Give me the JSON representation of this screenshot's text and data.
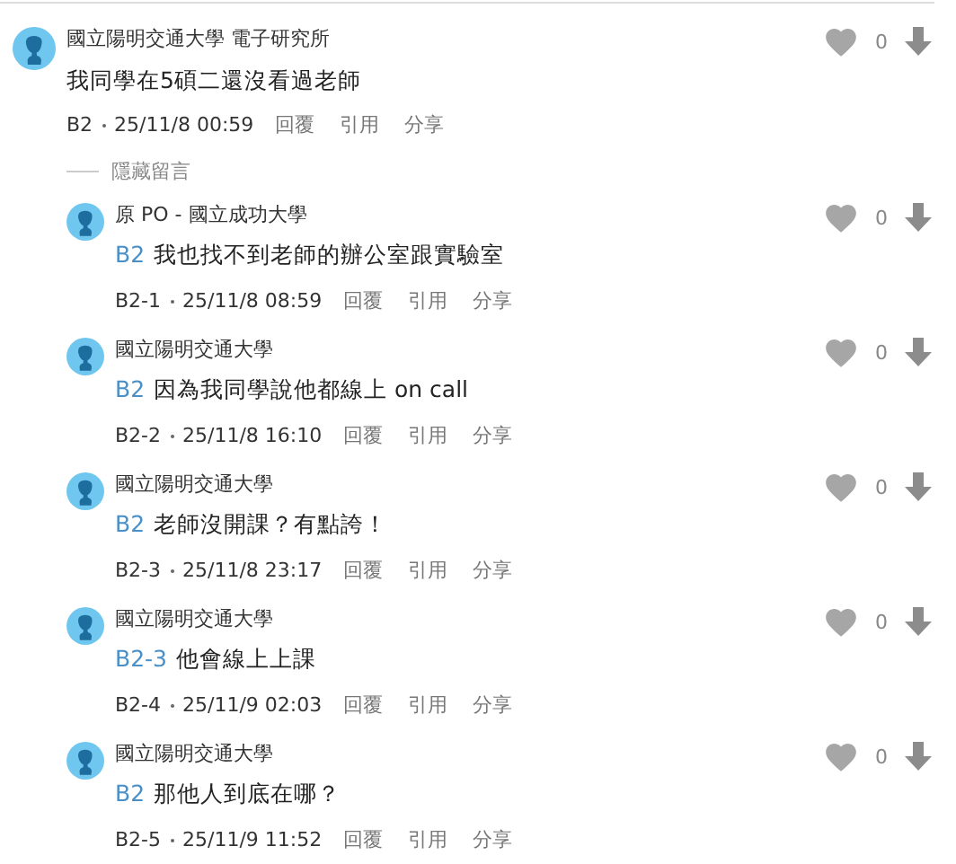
{
  "comment": {
    "author": "國立陽明交通大學 電子研究所",
    "text": "我同學在5碩二還沒看過老師",
    "floor": "B2",
    "time": "25/11/8 00:59",
    "actions": [
      "回覆",
      "引用",
      "分享"
    ],
    "likes": "0"
  },
  "hide_replies": {
    "label": "隱藏留言"
  },
  "replies": [
    {
      "author": "原 PO - 國立成功大學",
      "ref": "B2",
      "text": "我也找不到老師的辦公室跟實驗室",
      "floor": "B2-1",
      "time": "25/11/8 08:59",
      "actions": [
        "回覆",
        "引用",
        "分享"
      ],
      "likes": "0"
    },
    {
      "author": "國立陽明交通大學",
      "ref": "B2",
      "text": "因為我同學說他都線上 on call",
      "floor": "B2-2",
      "time": "25/11/8 16:10",
      "actions": [
        "回覆",
        "引用",
        "分享"
      ],
      "likes": "0"
    },
    {
      "author": "國立陽明交通大學",
      "ref": "B2",
      "text": "老師沒開課？有點誇！",
      "floor": "B2-3",
      "time": "25/11/8 23:17",
      "actions": [
        "回覆",
        "引用",
        "分享"
      ],
      "likes": "0"
    },
    {
      "author": "國立陽明交通大學",
      "ref": "B2-3",
      "text": "他會線上上課",
      "floor": "B2-4",
      "time": "25/11/9 02:03",
      "actions": [
        "回覆",
        "引用",
        "分享"
      ],
      "likes": "0"
    },
    {
      "author": "國立陽明交通大學",
      "ref": "B2",
      "text": "那他人到底在哪？",
      "floor": "B2-5",
      "time": "25/11/9 11:52",
      "actions": [
        "回覆",
        "引用",
        "分享"
      ],
      "likes": "0"
    }
  ]
}
